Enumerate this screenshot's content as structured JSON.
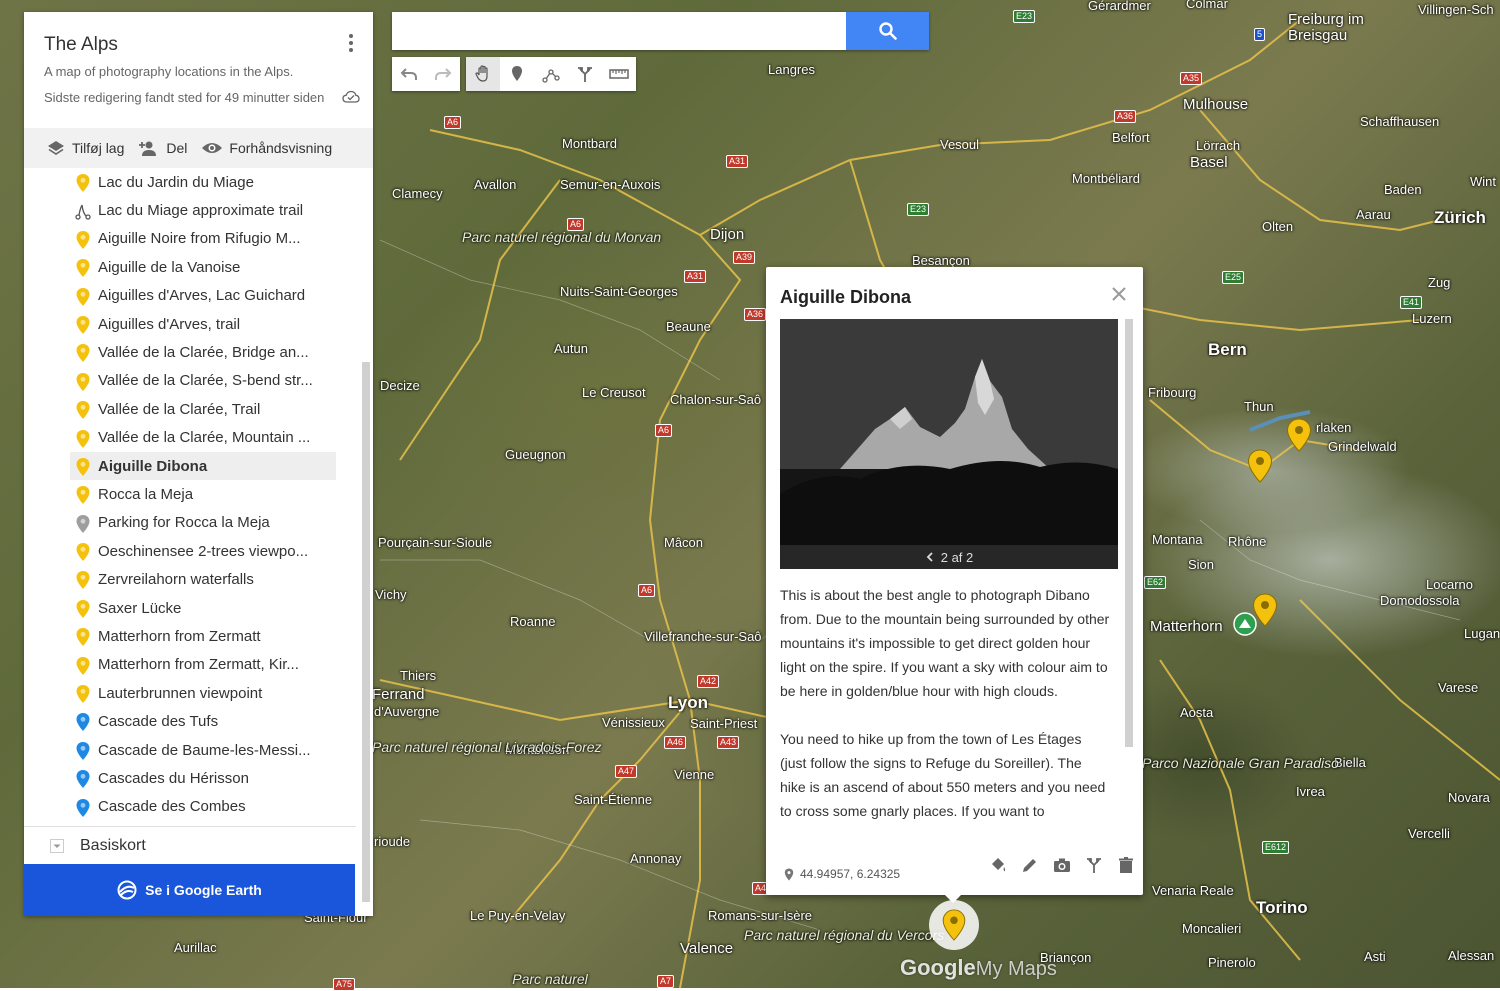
{
  "search": {
    "placeholder": ""
  },
  "panel": {
    "title": "The Alps",
    "description": "A map of photography locations in the Alps.",
    "status": "Sidste redigering fandt sted for 49 minutter siden",
    "actions": {
      "add_layer": "Tilføj lag",
      "share": "Del",
      "preview": "Forhåndsvisning"
    },
    "items": [
      {
        "label": "Lac du Jardin du Miage",
        "icon": "pin-yellow"
      },
      {
        "label": "Lac du Miage approximate trail",
        "icon": "path"
      },
      {
        "label": "Aiguille Noire from Rifugio M...",
        "icon": "pin-yellow"
      },
      {
        "label": "Aiguille de la Vanoise",
        "icon": "pin-yellow"
      },
      {
        "label": "Aiguilles d'Arves, Lac Guichard",
        "icon": "pin-yellow"
      },
      {
        "label": "Aiguilles d'Arves, trail",
        "icon": "pin-yellow"
      },
      {
        "label": "Vallée de la Clarée, Bridge an...",
        "icon": "pin-yellow"
      },
      {
        "label": "Vallée de la Clarée, S-bend str...",
        "icon": "pin-yellow"
      },
      {
        "label": "Vallée de la Clarée, Trail",
        "icon": "pin-yellow"
      },
      {
        "label": "Vallée de la Clarée, Mountain ...",
        "icon": "pin-yellow"
      },
      {
        "label": "Aiguille Dibona",
        "icon": "pin-yellow",
        "selected": true
      },
      {
        "label": "Rocca la Meja",
        "icon": "pin-yellow"
      },
      {
        "label": "Parking for Rocca la Meja",
        "icon": "pin-gray"
      },
      {
        "label": "Oeschinensee 2-trees viewpo...",
        "icon": "pin-yellow"
      },
      {
        "label": "Zervreilahorn waterfalls",
        "icon": "pin-yellow"
      },
      {
        "label": "Saxer Lücke",
        "icon": "pin-yellow"
      },
      {
        "label": "Matterhorn from Zermatt",
        "icon": "pin-yellow"
      },
      {
        "label": "Matterhorn from Zermatt, Kir...",
        "icon": "pin-yellow"
      },
      {
        "label": "Lauterbrunnen viewpoint",
        "icon": "pin-yellow"
      },
      {
        "label": "Cascade des Tufs",
        "icon": "pin-blue"
      },
      {
        "label": "Cascade de Baume-les-Messi...",
        "icon": "pin-blue"
      },
      {
        "label": "Cascades du Hérisson",
        "icon": "pin-blue"
      },
      {
        "label": "Cascade des Combes",
        "icon": "pin-blue"
      }
    ],
    "basemap_label": "Basiskort",
    "earth_button": "Se i Google Earth"
  },
  "card": {
    "title": "Aiguille Dibona",
    "photo_counter": "2 af 2",
    "paragraphs": [
      "This is about the best angle to photograph Dibano from. Due to the mountain being surrounded by other mountains it's impossible to get direct golden hour light on the spire. If you want a sky with colour aim to be here in golden/blue hour with high clouds.",
      "You need to hike up from the town of Les Étages (just follow the signs to Refuge du Soreiller). The hike is an ascend of about 550 meters and you need to cross some gnarly places. If you want to"
    ],
    "coordinates": "44.94957, 6.24325"
  },
  "map": {
    "places": [
      {
        "name": "Gérardmer",
        "cls": ""
      },
      {
        "name": "Colmar",
        "cls": ""
      },
      {
        "name": "Freiburg im Breisgau",
        "cls": "mid"
      },
      {
        "name": "Villingen-Sch",
        "cls": ""
      },
      {
        "name": "Langres",
        "cls": ""
      },
      {
        "name": "Mulhouse",
        "cls": "mid"
      },
      {
        "name": "Schaffhausen",
        "cls": ""
      },
      {
        "name": "Belfort",
        "cls": ""
      },
      {
        "name": "Lörrach",
        "cls": ""
      },
      {
        "name": "Basel",
        "cls": "mid"
      },
      {
        "name": "Montbard",
        "cls": ""
      },
      {
        "name": "Vesoul",
        "cls": ""
      },
      {
        "name": "Wint",
        "cls": ""
      },
      {
        "name": "Clamecy",
        "cls": ""
      },
      {
        "name": "Avallon",
        "cls": ""
      },
      {
        "name": "Semur-en-Auxois",
        "cls": ""
      },
      {
        "name": "Montbéliard",
        "cls": ""
      },
      {
        "name": "Baden",
        "cls": ""
      },
      {
        "name": "Aarau",
        "cls": ""
      },
      {
        "name": "Zürich",
        "cls": "big"
      },
      {
        "name": "Dijon",
        "cls": "mid"
      },
      {
        "name": "Olten",
        "cls": ""
      },
      {
        "name": "Besançon",
        "cls": ""
      },
      {
        "name": "Nuits-Saint-Georges",
        "cls": ""
      },
      {
        "name": "Zug",
        "cls": ""
      },
      {
        "name": "Beaune",
        "cls": ""
      },
      {
        "name": "Luzern",
        "cls": ""
      },
      {
        "name": "Autun",
        "cls": ""
      },
      {
        "name": "Bern",
        "cls": "big"
      },
      {
        "name": "Decize",
        "cls": ""
      },
      {
        "name": "Le Creusot",
        "cls": ""
      },
      {
        "name": "Chalon-sur-Saô",
        "cls": ""
      },
      {
        "name": "Fribourg",
        "cls": ""
      },
      {
        "name": "Thun",
        "cls": ""
      },
      {
        "name": "rlaken",
        "cls": ""
      },
      {
        "name": "Grindelwald",
        "cls": ""
      },
      {
        "name": "Gueugnon",
        "cls": ""
      },
      {
        "name": "Montana",
        "cls": ""
      },
      {
        "name": "Rhône",
        "cls": ""
      },
      {
        "name": "Sion",
        "cls": ""
      },
      {
        "name": "Locarno",
        "cls": ""
      },
      {
        "name": "Pourçain-sur-Sioule",
        "cls": ""
      },
      {
        "name": "Mâcon",
        "cls": ""
      },
      {
        "name": "Domodossola",
        "cls": ""
      },
      {
        "name": "Vichy",
        "cls": ""
      },
      {
        "name": "Matterhorn",
        "cls": "mid"
      },
      {
        "name": "Roanne",
        "cls": ""
      },
      {
        "name": "Villefranche-sur-Saô",
        "cls": ""
      },
      {
        "name": "Lugan",
        "cls": ""
      },
      {
        "name": "Thiers",
        "cls": ""
      },
      {
        "name": "Ferrand",
        "cls": "mid"
      },
      {
        "name": "Lyon",
        "cls": "big"
      },
      {
        "name": "Varese",
        "cls": ""
      },
      {
        "name": "d'Auvergne",
        "cls": ""
      },
      {
        "name": "Aosta",
        "cls": ""
      },
      {
        "name": "Vénissieux",
        "cls": ""
      },
      {
        "name": "Saint-Priest",
        "cls": ""
      },
      {
        "name": "Montbrison",
        "cls": ""
      },
      {
        "name": "Vienne",
        "cls": ""
      },
      {
        "name": "Biella",
        "cls": ""
      },
      {
        "name": "Saint-Étienne",
        "cls": ""
      },
      {
        "name": "Ivrea",
        "cls": ""
      },
      {
        "name": "Novara",
        "cls": ""
      },
      {
        "name": "Vercelli",
        "cls": ""
      },
      {
        "name": "rioude",
        "cls": ""
      },
      {
        "name": "Annonay",
        "cls": ""
      },
      {
        "name": "Venaria Reale",
        "cls": ""
      },
      {
        "name": "Torino",
        "cls": "big"
      },
      {
        "name": "Le Puy-en-Velay",
        "cls": ""
      },
      {
        "name": "Romans-sur-Isère",
        "cls": ""
      },
      {
        "name": "Moncalieri",
        "cls": ""
      },
      {
        "name": "Aurillac",
        "cls": ""
      },
      {
        "name": "Valence",
        "cls": "mid"
      },
      {
        "name": "Briançon",
        "cls": ""
      },
      {
        "name": "Pinerolo",
        "cls": ""
      },
      {
        "name": "Asti",
        "cls": ""
      },
      {
        "name": "Alessan",
        "cls": ""
      },
      {
        "name": "Saint-Flour",
        "cls": ""
      }
    ],
    "parks": [
      {
        "name": "Parc naturel régional du Morvan"
      },
      {
        "name": "Parc naturel régional Livradois-Forez"
      },
      {
        "name": "Parco Nazionale Gran Paradiso"
      },
      {
        "name": "Parc naturel régional du Vercors"
      },
      {
        "name": "Parc naturel"
      }
    ],
    "roads": [
      "A6",
      "A31",
      "A6",
      "A39",
      "A31",
      "A36",
      "A6",
      "A6",
      "A42",
      "A46",
      "A43",
      "A47",
      "A7",
      "A35",
      "A36",
      "E23",
      "E23",
      "E25",
      "E62",
      "E41",
      "E612",
      "5",
      "A75",
      "A4"
    ]
  },
  "colors": {
    "accent": "#4285f4",
    "earth_button": "#1a56db",
    "pin_yellow": "#f4c20d",
    "pin_blue": "#1e88e5",
    "pin_gray": "#9e9e9e"
  },
  "logo": {
    "google": "Google",
    "mymaps": "My Maps"
  }
}
